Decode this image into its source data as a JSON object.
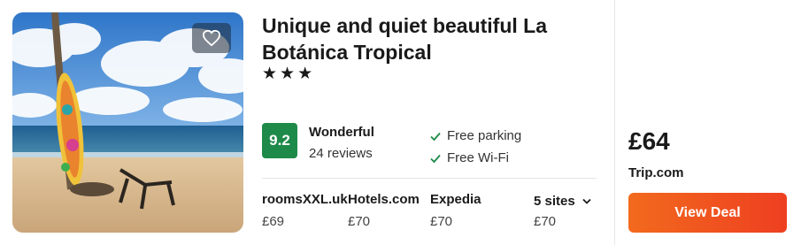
{
  "hotel": {
    "name": "Unique and quiet beautiful La Botánica Tropical",
    "stars": "★★★",
    "rating_score": "9.2",
    "rating_label": "Wonderful",
    "reviews": "24 reviews",
    "amenities": [
      "Free parking",
      "Free Wi-Fi"
    ]
  },
  "sites": [
    {
      "name": "roomsXXL.uk",
      "price": "£69"
    },
    {
      "name": "Hotels.com",
      "price": "£70"
    },
    {
      "name": "Expedia",
      "price": "£70"
    },
    {
      "name": "5 sites",
      "price": "£70"
    }
  ],
  "deal": {
    "price": "£64",
    "provider": "Trip.com",
    "button_label": "View Deal"
  },
  "icons": {
    "favorite": "heart-icon",
    "amenity": "check-icon",
    "more_sites": "chevron-down-icon"
  },
  "colors": {
    "rating_badge": "#1e8a4a",
    "deal_button": "#f0561f",
    "check": "#1e8a4a"
  }
}
